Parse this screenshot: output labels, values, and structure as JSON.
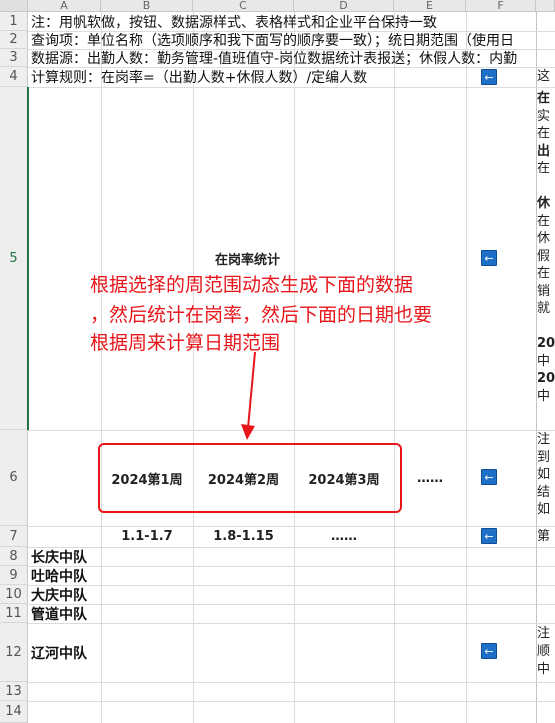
{
  "sheet": {
    "columns": [
      "A",
      "B",
      "C",
      "D",
      "E",
      "F"
    ],
    "rows": [
      "1",
      "2",
      "3",
      "4",
      "5",
      "6",
      "7",
      "8",
      "9",
      "10",
      "11",
      "12",
      "13",
      "14"
    ]
  },
  "notes": {
    "row1": "注：用帆软做，按钮、数据源样式、表格样式和企业平台保持一致",
    "row2": "查询项：单位名称（选项顺序和我下面写的顺序要一致）；统日期范围（使用日",
    "row3": "数据源：出勤人数：勤务管理-值班值守-岗位数据统计表报送；休假人数：内勤",
    "row4": "计算规则：在岗率=（出勤人数+休假人数）/定编人数"
  },
  "table": {
    "title": "在岗率统计",
    "weeks": [
      "2024第1周",
      "2024第2周",
      "2024第3周",
      "……"
    ],
    "ranges": [
      "1.1-1.7",
      "1.8-1.15",
      "……"
    ],
    "units": [
      "长庆中队",
      "吐哈中队",
      "大庆中队",
      "管道中队",
      "辽河中队"
    ]
  },
  "annotation": {
    "line1": "根据选择的周范围动态生成下面的数据",
    "line2": "，然后统计在岗率，然后下面的日期也要",
    "line3": "根据周来计算日期范围"
  },
  "side": {
    "r4": "这",
    "r5": [
      "在",
      "实",
      "在",
      "出",
      "在",
      "",
      "休",
      "在",
      "休",
      "假",
      "在",
      "销",
      "就",
      "",
      "20",
      "中",
      "20",
      "中"
    ],
    "r6": [
      "注",
      "到",
      "如",
      "结",
      "如"
    ],
    "r7": "第",
    "r12": [
      "注",
      "顺",
      "中"
    ]
  },
  "icons": {
    "cell_button": "left-arrow-icon",
    "color": "#1f6fc6"
  },
  "colors": {
    "annotation": "#e8161b",
    "selected_row": "#217346"
  }
}
